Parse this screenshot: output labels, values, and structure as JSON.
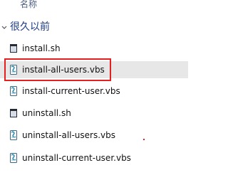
{
  "header": {
    "column_name": "名称"
  },
  "group": {
    "title": "很久以前",
    "icon": "chevron-down-icon"
  },
  "files": [
    {
      "name": "install.sh",
      "icon": "sh-file-icon",
      "selected": false
    },
    {
      "name": "install-all-users.vbs",
      "icon": "vbs-script-icon",
      "selected": true
    },
    {
      "name": "install-current-user.vbs",
      "icon": "vbs-script-icon",
      "selected": false
    },
    {
      "name": "uninstall.sh",
      "icon": "sh-file-icon",
      "selected": false
    },
    {
      "name": "uninstall-all-users.vbs",
      "icon": "vbs-script-icon",
      "selected": false
    },
    {
      "name": "uninstall-current-user.vbs",
      "icon": "vbs-script-icon",
      "selected": false
    }
  ],
  "colors": {
    "group_title": "#1e3b8a",
    "highlight_border": "#e31f1f",
    "selected_row": "#e7e7e7"
  }
}
